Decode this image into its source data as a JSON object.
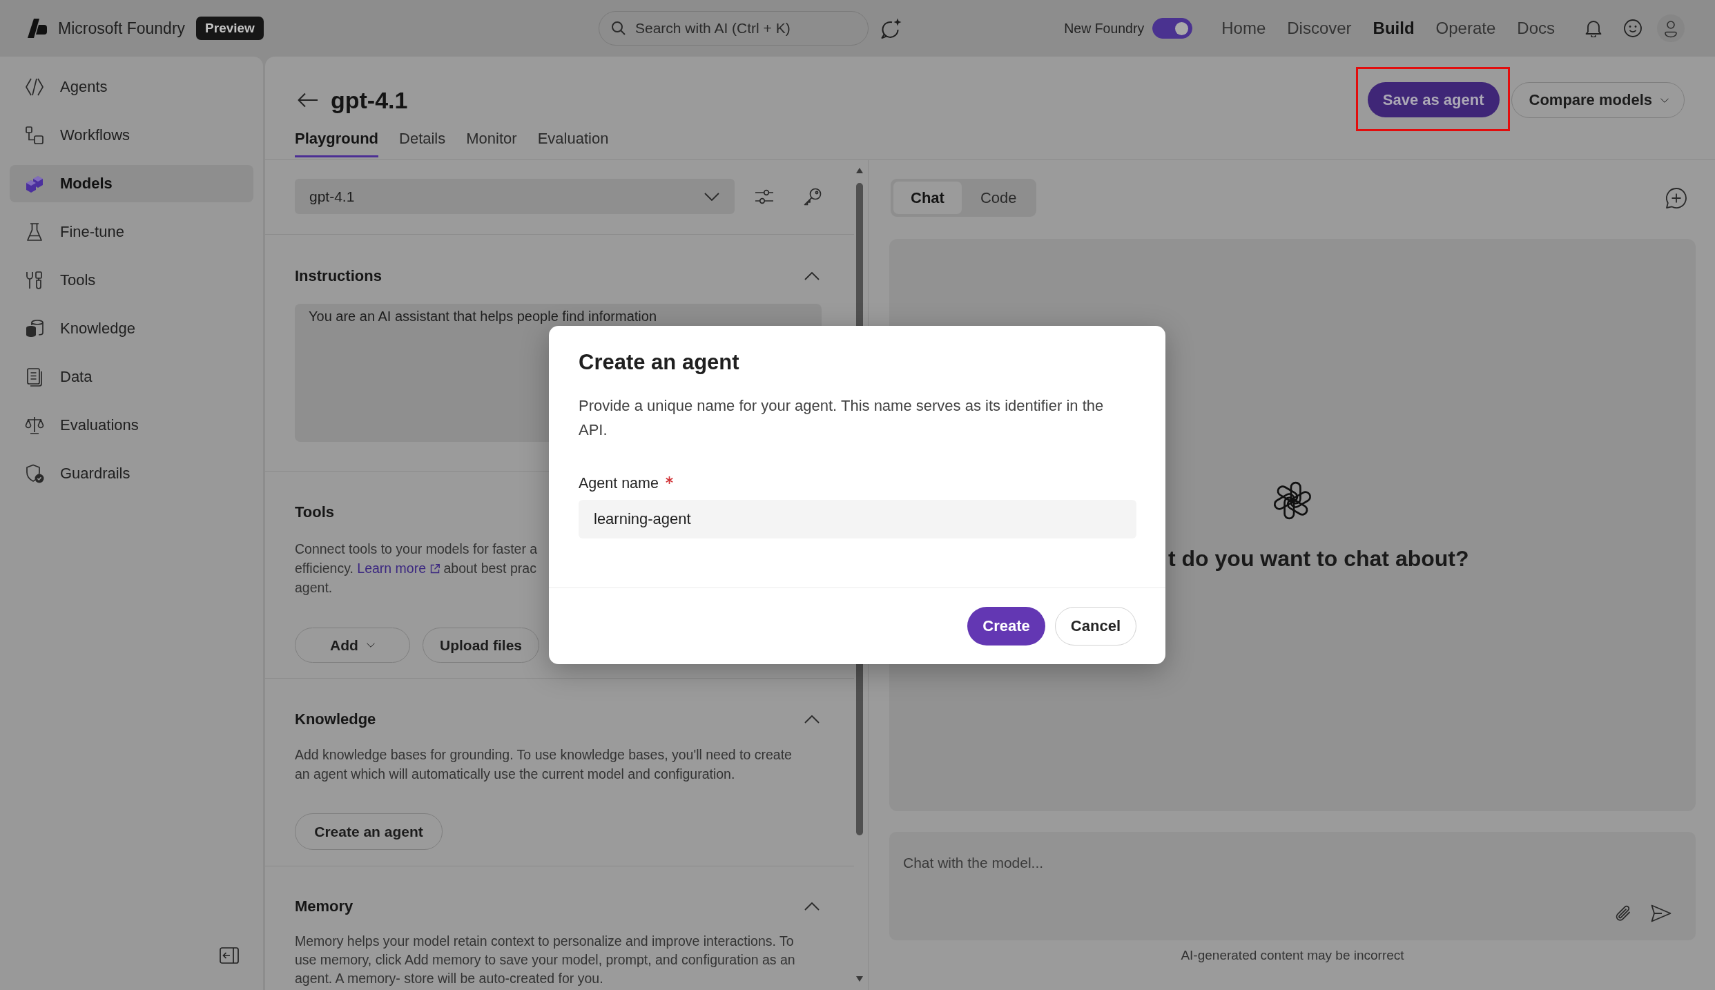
{
  "app": {
    "name": "Microsoft Foundry",
    "badge": "Preview"
  },
  "search": {
    "placeholder": "Search with AI (Ctrl + K)"
  },
  "toggle": {
    "label": "New Foundry",
    "on": true
  },
  "nav": [
    {
      "label": "Home",
      "selected": false
    },
    {
      "label": "Discover",
      "selected": false
    },
    {
      "label": "Build",
      "selected": true
    },
    {
      "label": "Operate",
      "selected": false
    },
    {
      "label": "Docs",
      "selected": false
    }
  ],
  "sidebar": {
    "items": [
      {
        "label": "Agents",
        "selected": false
      },
      {
        "label": "Workflows",
        "selected": false
      },
      {
        "label": "Models",
        "selected": true
      },
      {
        "label": "Fine-tune",
        "selected": false
      },
      {
        "label": "Tools",
        "selected": false
      },
      {
        "label": "Knowledge",
        "selected": false
      },
      {
        "label": "Data",
        "selected": false
      },
      {
        "label": "Evaluations",
        "selected": false
      },
      {
        "label": "Guardrails",
        "selected": false
      }
    ]
  },
  "page": {
    "title": "gpt-4.1",
    "tabs": [
      {
        "label": "Playground",
        "selected": true
      },
      {
        "label": "Details",
        "selected": false
      },
      {
        "label": "Monitor",
        "selected": false
      },
      {
        "label": "Evaluation",
        "selected": false
      }
    ]
  },
  "actions": [
    {
      "label": "Save as agent",
      "kind": "primary",
      "highlighted": true
    },
    {
      "label": "Compare models",
      "kind": "menu",
      "highlighted": false
    }
  ],
  "model_select": {
    "value": "gpt-4.1"
  },
  "sections": [
    {
      "title": "Instructions",
      "expanded": true,
      "value": "You are an AI assistant that helps people find information"
    },
    {
      "title": "Tools",
      "description_lines": [
        [
          {
            "kind": "text",
            "text": "Connect tools to your models for faster a"
          }
        ],
        [
          {
            "kind": "text",
            "text": "efficiency."
          },
          {
            "kind": "link",
            "text": "Learn more"
          },
          {
            "kind": "text",
            "text": "about best prac"
          }
        ],
        [
          {
            "kind": "text",
            "text": "agent."
          }
        ]
      ],
      "buttons": [
        {
          "label": "Add",
          "menu": true
        },
        {
          "label": "Upload files",
          "menu": false
        }
      ]
    },
    {
      "title": "Knowledge",
      "expanded": true,
      "description": "Add knowledge bases for grounding. To use knowledge bases, you'll need to create an agent which will automatically use the current model and configuration.",
      "buttons": [
        {
          "label": "Create an agent",
          "menu": false
        }
      ]
    },
    {
      "title": "Memory",
      "expanded": true,
      "description": "Memory helps your model retain context to personalize and improve interactions. To use memory, click Add memory to save your model, prompt, and configuration as an agent. A memory- store will be auto-created for you."
    }
  ],
  "chat": {
    "tabs": [
      {
        "label": "Chat",
        "selected": true
      },
      {
        "label": "Code",
        "selected": false
      }
    ],
    "prompt": "t do you want to chat about?",
    "input": {
      "placeholder": "Chat with the model..."
    },
    "disclaimer": "AI-generated content may be incorrect"
  },
  "dialog": {
    "title": "Create an agent",
    "description": "Provide a unique name for your agent. This name serves as its identifier in the API.",
    "field": {
      "label": "Agent name",
      "required": true,
      "value": "learning-agent"
    },
    "buttons": [
      {
        "label": "Create",
        "kind": "primary"
      },
      {
        "label": "Cancel",
        "kind": "secondary"
      }
    ]
  }
}
